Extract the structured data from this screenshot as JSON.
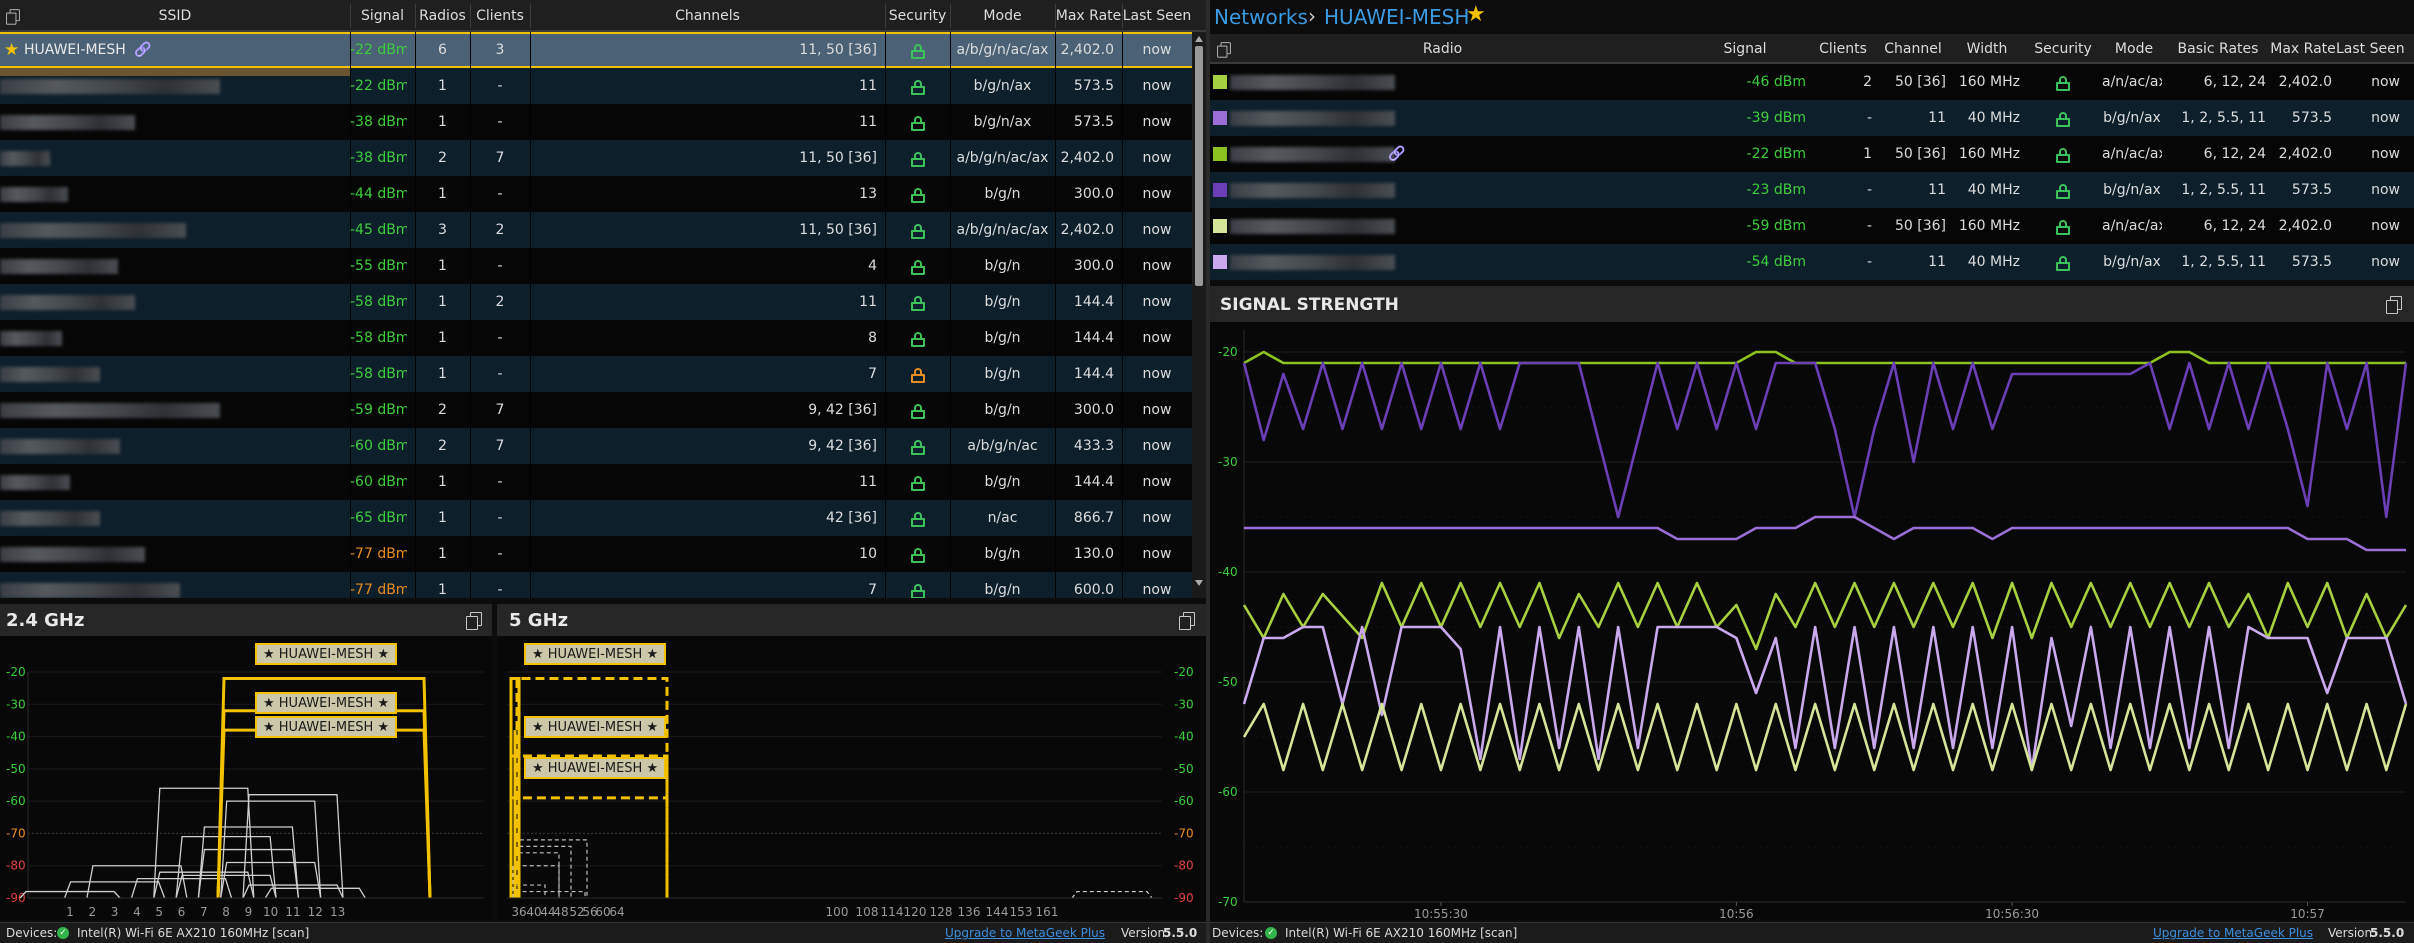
{
  "main_table": {
    "columns": [
      "SSID",
      "Signal",
      "Radios",
      "Clients",
      "Channels",
      "Security",
      "Mode",
      "Max Rate",
      "Last Seen"
    ],
    "rows": [
      {
        "ssid": "HUAWEI-MESH",
        "signal": "-22 dBm",
        "radios": "6",
        "clients": "3",
        "channels": "11, 50 [36]",
        "mode": "a/b/g/n/ac/ax",
        "max_rate": "2,402.0",
        "last_seen": "now",
        "favorite": true,
        "linked": true,
        "selected": true,
        "signal_color": "#3ccd3c",
        "lock": "green"
      },
      {
        "ssid": "",
        "signal": "-22 dBm",
        "radios": "1",
        "clients": "-",
        "channels": "11",
        "mode": "b/g/n/ax",
        "max_rate": "573.5",
        "last_seen": "now",
        "signal_color": "#3ccd3c",
        "lock": "green"
      },
      {
        "ssid": "",
        "signal": "-38 dBm",
        "radios": "1",
        "clients": "-",
        "channels": "11",
        "mode": "b/g/n/ax",
        "max_rate": "573.5",
        "last_seen": "now",
        "signal_color": "#3ccd3c",
        "lock": "green"
      },
      {
        "ssid": "",
        "signal": "-38 dBm",
        "radios": "2",
        "clients": "7",
        "channels": "11, 50 [36]",
        "mode": "a/b/g/n/ac/ax",
        "max_rate": "2,402.0",
        "last_seen": "now",
        "signal_color": "#3ccd3c",
        "lock": "green"
      },
      {
        "ssid": "",
        "signal": "-44 dBm",
        "radios": "1",
        "clients": "-",
        "channels": "13",
        "mode": "b/g/n",
        "max_rate": "300.0",
        "last_seen": "now",
        "signal_color": "#3ccd3c",
        "lock": "green"
      },
      {
        "ssid": "",
        "signal": "-45 dBm",
        "radios": "3",
        "clients": "2",
        "channels": "11, 50 [36]",
        "mode": "a/b/g/n/ac/ax",
        "max_rate": "2,402.0",
        "last_seen": "now",
        "signal_color": "#3ccd3c",
        "lock": "green"
      },
      {
        "ssid": "",
        "signal": "-55 dBm",
        "radios": "1",
        "clients": "-",
        "channels": "4",
        "mode": "b/g/n",
        "max_rate": "300.0",
        "last_seen": "now",
        "signal_color": "#3ccd3c",
        "lock": "green"
      },
      {
        "ssid": "",
        "signal": "-58 dBm",
        "radios": "1",
        "clients": "2",
        "channels": "11",
        "mode": "b/g/n",
        "max_rate": "144.4",
        "last_seen": "now",
        "signal_color": "#3ccd3c",
        "lock": "green"
      },
      {
        "ssid": "",
        "signal": "-58 dBm",
        "radios": "1",
        "clients": "-",
        "channels": "8",
        "mode": "b/g/n",
        "max_rate": "144.4",
        "last_seen": "now",
        "signal_color": "#3ccd3c",
        "lock": "green"
      },
      {
        "ssid": "",
        "signal": "-58 dBm",
        "radios": "1",
        "clients": "-",
        "channels": "7",
        "mode": "b/g/n",
        "max_rate": "144.4",
        "last_seen": "now",
        "signal_color": "#3ccd3c",
        "lock": "orange"
      },
      {
        "ssid": "",
        "signal": "-59 dBm",
        "radios": "2",
        "clients": "7",
        "channels": "9, 42 [36]",
        "mode": "b/g/n",
        "max_rate": "300.0",
        "last_seen": "now",
        "signal_color": "#3ccd3c",
        "lock": "green"
      },
      {
        "ssid": "",
        "signal": "-60 dBm",
        "radios": "2",
        "clients": "7",
        "channels": "9, 42 [36]",
        "mode": "a/b/g/n/ac",
        "max_rate": "433.3",
        "last_seen": "now",
        "signal_color": "#3ccd3c",
        "lock": "green"
      },
      {
        "ssid": "",
        "signal": "-60 dBm",
        "radios": "1",
        "clients": "-",
        "channels": "11",
        "mode": "b/g/n",
        "max_rate": "144.4",
        "last_seen": "now",
        "signal_color": "#3ccd3c",
        "lock": "green"
      },
      {
        "ssid": "",
        "signal": "-65 dBm",
        "radios": "1",
        "clients": "-",
        "channels": "42 [36]",
        "mode": "n/ac",
        "max_rate": "866.7",
        "last_seen": "now",
        "signal_color": "#3ccd3c",
        "lock": "green"
      },
      {
        "ssid": "",
        "signal": "-77 dBm",
        "radios": "1",
        "clients": "-",
        "channels": "10",
        "mode": "b/g/n",
        "max_rate": "130.0",
        "last_seen": "now",
        "signal_color": "#e78b23",
        "lock": "green"
      },
      {
        "ssid": "",
        "signal": "-77 dBm",
        "radios": "1",
        "clients": "-",
        "channels": "7",
        "mode": "b/g/n",
        "max_rate": "600.0",
        "last_seen": "now",
        "signal_color": "#e78b23",
        "lock": "green"
      }
    ]
  },
  "ghz24": {
    "title": "2.4 GHz",
    "yticks": [
      "-20",
      "-30",
      "-40",
      "-50",
      "-60",
      "-70",
      "-80",
      "-90"
    ],
    "xticks": [
      "1",
      "2",
      "3",
      "4",
      "5",
      "6",
      "7",
      "8",
      "9",
      "10",
      "11",
      "12",
      "13"
    ],
    "tags": [
      "★ HUAWEI-MESH ★",
      "★ HUAWEI-MESH ★",
      "★ HUAWEI-MESH ★"
    ]
  },
  "ghz5": {
    "title": "5 GHz",
    "yticks": [
      "-20",
      "-30",
      "-40",
      "-50",
      "-60",
      "-70",
      "-80",
      "-90"
    ],
    "xticks": [
      "36",
      "40",
      "44",
      "48",
      "52",
      "56",
      "60",
      "64",
      "100",
      "108",
      "114",
      "120",
      "128",
      "136",
      "144",
      "153",
      "161"
    ],
    "tags": [
      "★ HUAWEI-MESH ★",
      "★ HUAWEI-MESH ★",
      "★ HUAWEI-MESH ★"
    ]
  },
  "status_left": {
    "devices_label": "Devices:",
    "device": "Intel(R) Wi-Fi 6E AX210 160MHz [scan]",
    "upgrade": "Upgrade to MetaGeek Plus",
    "version_label": "Version",
    "version": "5.5.0"
  },
  "breadcrumb": {
    "root": "Networks",
    "current": "HUAWEI-MESH"
  },
  "radio_table": {
    "columns": [
      "Radio",
      "Signal",
      "Clients",
      "Channel",
      "Width",
      "Security",
      "Mode",
      "Basic Rates",
      "Max Rate",
      "Last Seen"
    ],
    "rows": [
      {
        "color": "#a6d03f",
        "signal": "-46 dBm",
        "clients": "2",
        "channel": "50 [36]",
        "width": "160 MHz",
        "mode": "a/n/ac/ax",
        "basic": "6, 12, 24",
        "max_rate": "2,402.0",
        "last_seen": "now",
        "linked": false
      },
      {
        "color": "#9a6ed6",
        "signal": "-39 dBm",
        "clients": "-",
        "channel": "11",
        "width": "40 MHz",
        "mode": "b/g/n/ax",
        "basic": "1, 2, 5.5, 11",
        "max_rate": "573.5",
        "last_seen": "now",
        "linked": false
      },
      {
        "color": "#8bc21f",
        "signal": "-22 dBm",
        "clients": "1",
        "channel": "50 [36]",
        "width": "160 MHz",
        "mode": "a/n/ac/ax",
        "basic": "6, 12, 24",
        "max_rate": "2,402.0",
        "last_seen": "now",
        "linked": true
      },
      {
        "color": "#6a3fb6",
        "signal": "-23 dBm",
        "clients": "-",
        "channel": "11",
        "width": "40 MHz",
        "mode": "b/g/n/ax",
        "basic": "1, 2, 5.5, 11",
        "max_rate": "573.5",
        "last_seen": "now",
        "linked": false
      },
      {
        "color": "#d4e59a",
        "signal": "-59 dBm",
        "clients": "-",
        "channel": "50 [36]",
        "width": "160 MHz",
        "mode": "a/n/ac/ax",
        "basic": "6, 12, 24",
        "max_rate": "2,402.0",
        "last_seen": "now",
        "linked": false
      },
      {
        "color": "#c9a8ee",
        "signal": "-54 dBm",
        "clients": "-",
        "channel": "11",
        "width": "40 MHz",
        "mode": "b/g/n/ax",
        "basic": "1, 2, 5.5, 11",
        "max_rate": "573.5",
        "last_seen": "now",
        "linked": false
      }
    ]
  },
  "signal_panel": {
    "title": "SIGNAL STRENGTH"
  },
  "chart_data": {
    "type": "line",
    "title": "SIGNAL STRENGTH",
    "xlabel": "",
    "ylabel": "",
    "ylim": [
      -70,
      -18
    ],
    "yticks": [
      "-20",
      "-30",
      "-40",
      "-50",
      "-60",
      "-70"
    ],
    "x": [
      0,
      1,
      2,
      3,
      4,
      5,
      6,
      7,
      8,
      9,
      10,
      11,
      12,
      13,
      14,
      15,
      16,
      17,
      18,
      19,
      20,
      21,
      22,
      23,
      24,
      25,
      26,
      27,
      28,
      29,
      30,
      31,
      32,
      33,
      34,
      35,
      36,
      37,
      38,
      39,
      40,
      41,
      42,
      43,
      44,
      45,
      46,
      47,
      48,
      49,
      50,
      51,
      52,
      53,
      54,
      55,
      56,
      57,
      58,
      59
    ],
    "xticks": [
      {
        "pos": 10,
        "label": "10:55:30"
      },
      {
        "pos": 25,
        "label": "10:56"
      },
      {
        "pos": 39,
        "label": "10:56:30"
      },
      {
        "pos": 54,
        "label": "10:57"
      }
    ],
    "series": [
      {
        "color": "#8bc21f",
        "values": [
          -21,
          -20,
          -21,
          -21,
          -21,
          -21,
          -21,
          -21,
          -21,
          -21,
          -21,
          -21,
          -21,
          -21,
          -21,
          -21,
          -21,
          -21,
          -21,
          -21,
          -21,
          -21,
          -21,
          -21,
          -21,
          -21,
          -20,
          -20,
          -21,
          -21,
          -21,
          -21,
          -21,
          -21,
          -21,
          -21,
          -21,
          -21,
          -21,
          -21,
          -21,
          -21,
          -21,
          -21,
          -21,
          -21,
          -21,
          -20,
          -20,
          -21,
          -21,
          -21,
          -21,
          -21,
          -21,
          -21,
          -21,
          -21,
          -21,
          -21
        ]
      },
      {
        "color": "#6a3fb6",
        "values": [
          -21,
          -28,
          -22,
          -27,
          -21,
          -27,
          -21,
          -27,
          -21,
          -27,
          -21,
          -27,
          -21,
          -27,
          -21,
          -21,
          -21,
          -21,
          -28,
          -35,
          -28,
          -21,
          -27,
          -21,
          -27,
          -21,
          -27,
          -21,
          -21,
          -21,
          -27,
          -35,
          -27,
          -21,
          -30,
          -21,
          -27,
          -21,
          -27,
          -22,
          -22,
          -22,
          -22,
          -22,
          -22,
          -22,
          -21,
          -27,
          -21,
          -27,
          -21,
          -27,
          -21,
          -27,
          -34,
          -21,
          -27,
          -21,
          -35,
          -21
        ]
      },
      {
        "color": "#9a6ed6",
        "values": [
          -36,
          -36,
          -36,
          -36,
          -36,
          -36,
          -36,
          -36,
          -36,
          -36,
          -36,
          -36,
          -36,
          -36,
          -36,
          -36,
          -36,
          -36,
          -36,
          -36,
          -36,
          -36,
          -37,
          -37,
          -37,
          -37,
          -36,
          -36,
          -36,
          -35,
          -35,
          -35,
          -36,
          -37,
          -36,
          -36,
          -36,
          -36,
          -37,
          -36,
          -36,
          -36,
          -36,
          -36,
          -36,
          -36,
          -36,
          -36,
          -36,
          -36,
          -36,
          -36,
          -36,
          -36,
          -37,
          -37,
          -37,
          -38,
          -38,
          -38
        ]
      },
      {
        "color": "#a6d03f",
        "values": [
          -43,
          -46,
          -42,
          -45,
          -42,
          -44,
          -46,
          -41,
          -45,
          -41,
          -45,
          -41,
          -45,
          -41,
          -45,
          -41,
          -46,
          -42,
          -45,
          -41,
          -45,
          -41,
          -45,
          -41,
          -45,
          -43,
          -47,
          -42,
          -45,
          -41,
          -45,
          -41,
          -45,
          -41,
          -45,
          -41,
          -45,
          -41,
          -46,
          -41,
          -46,
          -41,
          -45,
          -41,
          -45,
          -41,
          -45,
          -41,
          -45,
          -41,
          -45,
          -42,
          -46,
          -41,
          -45,
          -41,
          -46,
          -42,
          -46,
          -43
        ]
      },
      {
        "color": "#c9a8ee",
        "values": [
          -52,
          -46,
          -46,
          -45,
          -45,
          -52,
          -45,
          -53,
          -45,
          -45,
          -45,
          -47,
          -57,
          -45,
          -57,
          -45,
          -56,
          -45,
          -57,
          -45,
          -56,
          -45,
          -45,
          -45,
          -45,
          -46,
          -51,
          -46,
          -56,
          -45,
          -56,
          -45,
          -56,
          -45,
          -56,
          -45,
          -56,
          -45,
          -56,
          -45,
          -58,
          -46,
          -54,
          -45,
          -56,
          -45,
          -56,
          -45,
          -56,
          -45,
          -56,
          -45,
          -46,
          -46,
          -46,
          -51,
          -46,
          -46,
          -46,
          -52
        ]
      },
      {
        "color": "#d4e59a",
        "values": [
          -55,
          -52,
          -58,
          -52,
          -58,
          -52,
          -58,
          -52,
          -58,
          -52,
          -58,
          -52,
          -58,
          -52,
          -58,
          -52,
          -58,
          -52,
          -58,
          -52,
          -58,
          -52,
          -58,
          -52,
          -58,
          -52,
          -58,
          -52,
          -58,
          -52,
          -58,
          -52,
          -58,
          -52,
          -58,
          -52,
          -58,
          -52,
          -58,
          -52,
          -58,
          -52,
          -58,
          -52,
          -58,
          -52,
          -58,
          -52,
          -58,
          -52,
          -58,
          -52,
          -58,
          -52,
          -58,
          -52,
          -58,
          -52,
          -58,
          -52
        ]
      }
    ]
  },
  "status_right": {
    "devices_label": "Devices:",
    "device": "Intel(R) Wi-Fi 6E AX210 160MHz [scan]",
    "upgrade": "Upgrade to MetaGeek Plus",
    "version_label": "Version",
    "version": "5.5.0"
  }
}
